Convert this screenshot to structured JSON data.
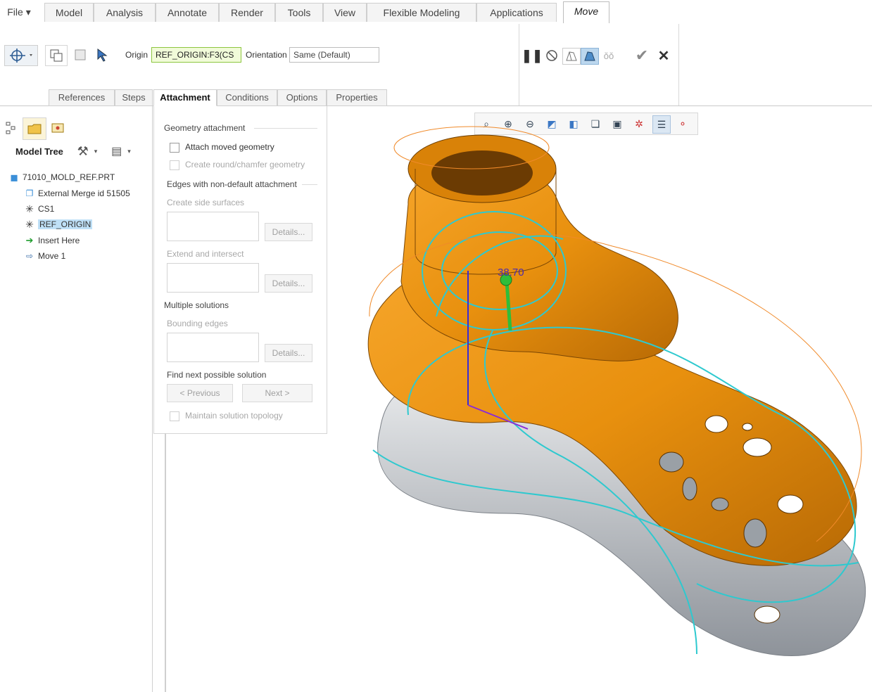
{
  "menu": {
    "file": "File",
    "tabs": [
      "Model",
      "Analysis",
      "Annotate",
      "Render",
      "Tools",
      "View",
      "Flexible Modeling",
      "Applications"
    ],
    "active_tab": "Move"
  },
  "ribbon": {
    "origin_label": "Origin",
    "origin_value": "REF_ORIGIN:F3(CS",
    "orientation_label": "Orientation",
    "orientation_value": "Same (Default)",
    "subtabs": [
      "References",
      "Steps",
      "Attachment",
      "Conditions",
      "Options",
      "Properties"
    ],
    "active_subtab": "Attachment"
  },
  "model_tree": {
    "title": "Model Tree",
    "items": [
      {
        "label": "71010_MOLD_REF.PRT",
        "icon": "part-icon"
      },
      {
        "label": "External Merge id 51505",
        "icon": "merge-icon"
      },
      {
        "label": "CS1",
        "icon": "csys-icon"
      },
      {
        "label": "REF_ORIGIN",
        "icon": "csys-icon"
      },
      {
        "label": "Insert Here",
        "icon": "insert-arrow-icon"
      },
      {
        "label": "Move 1",
        "icon": "move-feature-icon"
      }
    ]
  },
  "attachment": {
    "geometry_attachment": "Geometry attachment",
    "attach_moved": "Attach moved geometry",
    "create_round": "Create round/chamfer geometry",
    "edges_header": "Edges with non-default attachment",
    "create_side": "Create side surfaces",
    "details": "Details...",
    "extend_intersect": "Extend and intersect",
    "multiple_solutions": "Multiple solutions",
    "bounding_edges": "Bounding edges",
    "find_next": "Find next possible solution",
    "previous": "< Previous",
    "next": "Next >",
    "maintain_topology": "Maintain solution topology"
  },
  "viewport": {
    "dimension_value": "38.70"
  },
  "colors": {
    "part_orange": "#e8900e",
    "mold_gray": "#a9adb3",
    "wire_cyan": "#2ec9cf",
    "accent_green": "#2fbd3a"
  }
}
